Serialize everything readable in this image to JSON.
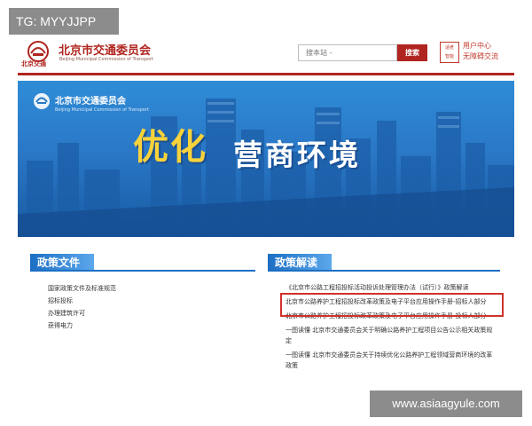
{
  "watermarks": {
    "tag": "TG: MYYJJPP",
    "site": "www.asiaagyule.com"
  },
  "header": {
    "logo_sub": "北京交通",
    "title": "北京市交通委员会",
    "subtitle": "Beijing Municipal Commission of Transport",
    "search_placeholder": "搜本站 -",
    "search_button": "搜索",
    "badge_line1": "适老",
    "badge_line2": "智能",
    "user_center": "用户中心",
    "accessible": "无障碍交流"
  },
  "banner": {
    "org": "北京市交通委员会",
    "org_en": "Beijing Municipal Commission of Transport",
    "slogan_main": "优化",
    "slogan_sub": "营商环境"
  },
  "sections": {
    "left": {
      "title": "政策文件",
      "items": [
        "国家政策文件及标准规范",
        "招标投标",
        "办理建筑许可",
        "获得电力"
      ]
    },
    "right": {
      "title": "政策解读",
      "items": [
        "《北京市公路工程招投标活动投诉处理管理办法（试行）》政策解读",
        "北京市公路养护工程招投标改革政策及电子平台应用操作手册-招标人部分",
        "北京市公路养护工程招投标改革政策及电子平台应用操作手册-投标人部分",
        "一图读懂 北京市交通委员会关于明确公路养护工程项目公告公示相关政策规定",
        "一图读懂 北京市交通委员会关于持续优化公路养护工程领域营商环境的改革政策"
      ]
    }
  },
  "colors": {
    "brand_red": "#b0251f",
    "section_blue": "#1d6fc4",
    "slogan_yellow": "#f7d23a",
    "highlight_red": "#d0322a"
  }
}
